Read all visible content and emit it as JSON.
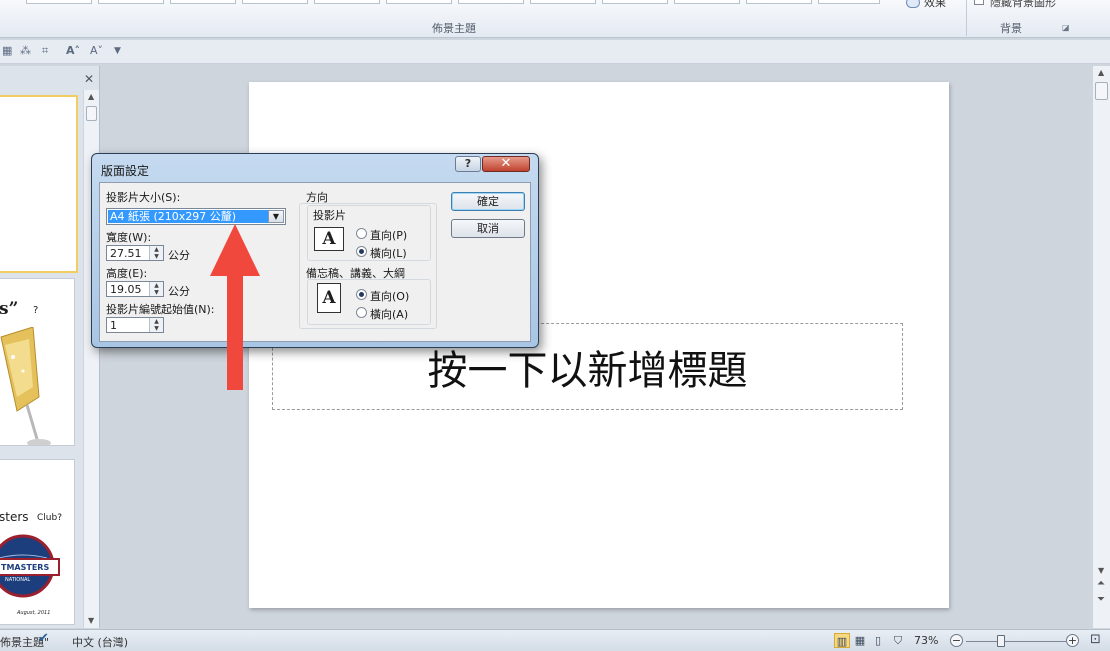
{
  "ribbon": {
    "theme_group_label": "佈景主題",
    "effects_label": "效果",
    "hide_bg_label": "隱藏背景圖形",
    "background_group_label": "背景"
  },
  "slide_panel": {
    "thumb2_text": "s”",
    "thumb2_q": "?",
    "thumb3_line1": "sters",
    "thumb3_line1b": "Club?",
    "thumb3_logo": "TMASTERS",
    "thumb3_logo2": "NATIONAL",
    "thumb3_foot": "August, 2011"
  },
  "slide": {
    "title_placeholder": "按一下以新增標題"
  },
  "dialog": {
    "title": "版面設定",
    "help_label": "?",
    "close_label": "✕",
    "size_label": "投影片大小(S):",
    "size_value": "A4 紙張 (210x297 公釐)",
    "width_label": "寬度(W):",
    "width_value": "27.51",
    "width_unit": "公分",
    "height_label": "高度(E):",
    "height_value": "19.05",
    "height_unit": "公分",
    "numbering_label": "投影片編號起始值(N):",
    "numbering_value": "1",
    "orientation_label": "方向",
    "slides_group_label": "投影片",
    "slides_portrait": "直向(P)",
    "slides_landscape": "橫向(L)",
    "notes_group_label": "備忘稿、講義、大綱",
    "notes_portrait": "直向(O)",
    "notes_landscape": "橫向(A)",
    "ok_label": "確定",
    "cancel_label": "取消",
    "icon_letter": "A"
  },
  "status_bar": {
    "theme_name": "佈景主題\"",
    "language": "中文 (台灣)",
    "zoom": "73%"
  },
  "colors": {
    "annotation_arrow": "#f0483c",
    "selection": "#3399ff"
  }
}
